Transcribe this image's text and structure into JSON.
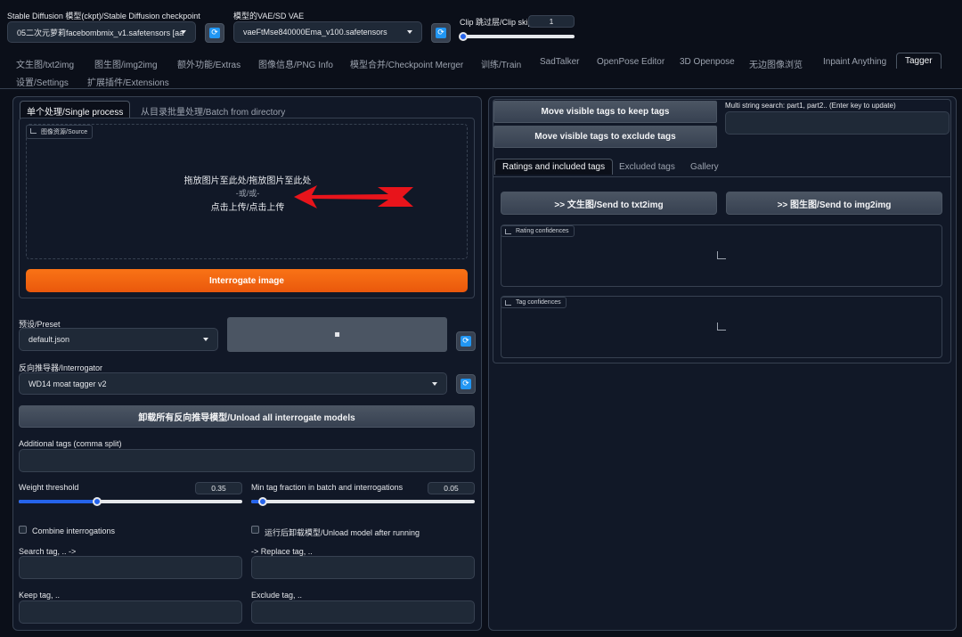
{
  "header": {
    "ckpt_label": "Stable Diffusion 模型(ckpt)/Stable Diffusion checkpoint",
    "ckpt_value": "05二次元萝莉facebombmix_v1.safetensors [aa",
    "vae_label": "模型的VAE/SD VAE",
    "vae_value": "vaeFtMse840000Ema_v100.safetensors",
    "clip_label": "Clip 跳过层/Clip skip",
    "clip_value": "1",
    "clip_skip_level": 1
  },
  "tabs_row1": [
    "文生图/txt2img",
    "图生图/img2img",
    "额外功能/Extras",
    "图像信息/PNG Info",
    "模型合并/Checkpoint Merger",
    "训练/Train",
    "SadTalker",
    "OpenPose Editor",
    "3D Openpose",
    "无边图像浏览",
    "Inpaint Anything",
    "Tagger"
  ],
  "tabs_row2": [
    "设置/Settings",
    "扩展插件/Extensions"
  ],
  "left": {
    "subtabs": [
      "单个处理/Single process",
      "从目录批量处理/Batch from directory"
    ],
    "source_label": "图像资源/Source",
    "drop_line1": "拖放图片至此处/拖放图片至此处",
    "drop_line2": "-或/或-",
    "drop_line3": "点击上传/点击上传",
    "interrogate_btn": "Interrogate image",
    "preset_label": "预设/Preset",
    "preset_value": "default.json",
    "save_icon": "floppy-disk-icon",
    "interrogator_label": "反向推导器/Interrogator",
    "interrogator_value": "WD14 moat tagger v2",
    "unload_btn": "卸载所有反向推导模型/Unload all interrogate models",
    "additional_tags_label": "Additional tags (comma split)",
    "weight_label": "Weight threshold",
    "weight_value": "0.35",
    "weight_fraction": 0.35,
    "min_tag_label": "Min tag fraction in batch and interrogations",
    "min_tag_value": "0.05",
    "min_tag_fraction": 0.05,
    "combine_label": "Combine interrogations",
    "unload_after_label": "运行后卸载模型/Unload model after running",
    "search_tag_label": "Search tag, .. ->",
    "replace_tag_label": "-> Replace tag, ..",
    "keep_tag_label": "Keep tag, ..",
    "exclude_tag_label": "Exclude tag, .."
  },
  "right": {
    "keep_btn": "Move visible tags to keep tags",
    "exclude_btn": "Move visible tags to exclude tags",
    "multi_search_label": "Multi string search: part1, part2.. (Enter key to update)",
    "subtabs": [
      "Ratings and included tags",
      "Excluded tags",
      "Gallery"
    ],
    "send_txt2img": ">> 文生图/Send to txt2img",
    "send_img2img": ">> 图生图/Send to img2img",
    "rating_label": "Rating confidences",
    "tag_conf_label": "Tag confidences"
  },
  "colors": {
    "accent_orange": "#f97316",
    "refresh_blue": "#2196f3",
    "slider_blue": "#2563eb",
    "arrow_red": "#e8141b"
  }
}
